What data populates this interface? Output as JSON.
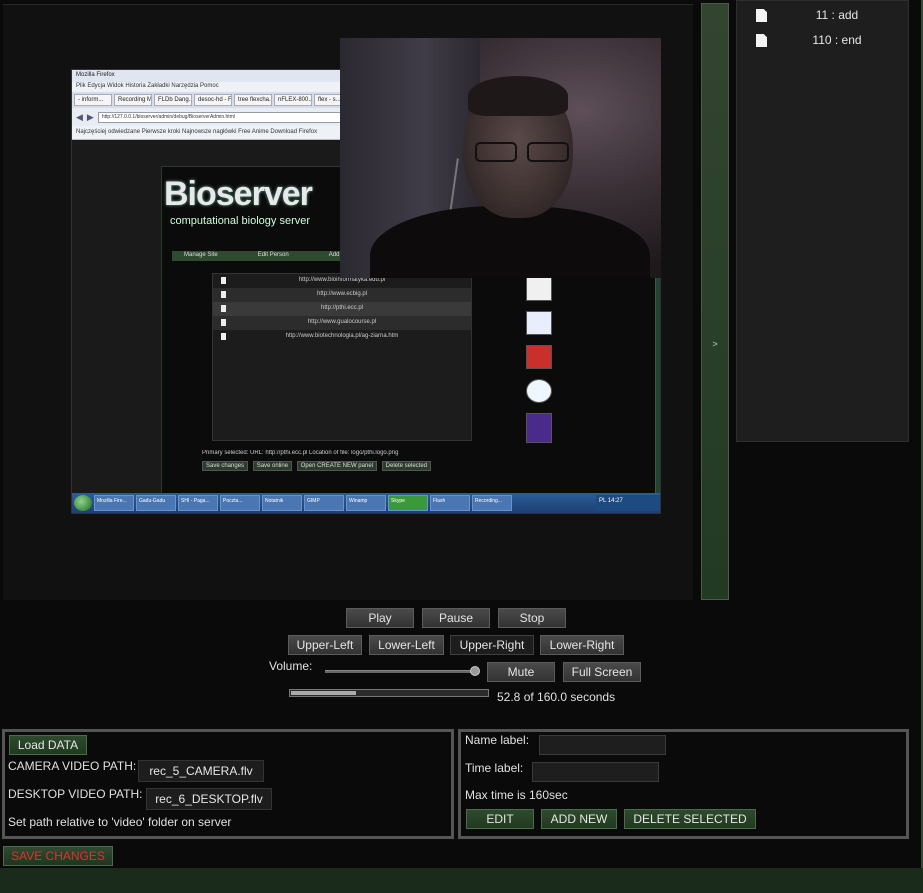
{
  "player": {
    "buttons": {
      "play": "Play",
      "pause": "Pause",
      "stop": "Stop"
    },
    "positions": {
      "upper_left": "Upper-Left",
      "lower_left": "Lower-Left",
      "upper_right": "Upper-Right",
      "lower_right": "Lower-Right"
    },
    "volume_label": "Volume:",
    "volume_level": 1.0,
    "mute": "Mute",
    "full_screen": "Full Screen",
    "progress_fraction": 0.33,
    "time_status": "52.8 of 160.0 seconds",
    "toggle_glyph": ">"
  },
  "events": [
    {
      "label": "11 : add",
      "icon": "document-icon"
    },
    {
      "label": "110 : end",
      "icon": "document-icon"
    }
  ],
  "load_panel": {
    "load_button": "Load DATA",
    "camera_label": "CAMERA VIDEO PATH:",
    "camera_value": "rec_5_CAMERA.flv",
    "desktop_label": "DESKTOP VIDEO PATH:",
    "desktop_value": "rec_6_DESKTOP.flv",
    "hint": "Set path relative to 'video' folder on server"
  },
  "label_panel": {
    "name_label": "Name label:",
    "name_value": "",
    "time_label": "Time label:",
    "time_value": "",
    "max_time": "Max time is 160sec",
    "edit": "EDIT",
    "add_new": "ADD NEW",
    "delete_selected": "DELETE SELECTED"
  },
  "save_changes": "SAVE CHANGES",
  "video_content": {
    "browser": {
      "title": "Mozilla Firefox",
      "menu": "Plik  Edycja  Widok  Historia  Zakładki  Narzędzia  Pomoc",
      "tabs": [
        "- inform...",
        "Recording Me...",
        "FLDb Dang...",
        "desoc-hd - F...",
        "tree flexcha...",
        "nFLEX-800...",
        "flex - s..."
      ],
      "url": "http://127.0.0.1/bioserver/admin/debug/BioserverAdmin.html",
      "bookmarks": "Najczęściej odwiedzane   Pierwsze kroki   Najnowsze nagłówki   Free Anime Download   Firefox"
    },
    "site": {
      "logo": "Bioserver",
      "subtitle": "computational biology server",
      "nav": [
        "Manage Site",
        "Edit Person",
        "Add Person"
      ],
      "links": [
        "http://www.bioinformatyka.edu.pl",
        "http://www.ecbig.pl",
        "http://pthi.ecc.pl",
        "http://www.gualocourse.pl",
        "http://www.biotechnologia.pl/ag-ziarna.htm"
      ],
      "form_text": "Primary selected:  URL: http://pthi.ecc.pl   Location of file: logo/pthi.logo.png",
      "form_buttons": [
        "Save changes",
        "Save online",
        "Open CREATE NEW panel",
        "Delete selected"
      ]
    },
    "taskbar": {
      "items": [
        "Mozilla Fire...",
        "Gadu-Gadu",
        "SHI - Paga...",
        "Poczta...",
        "Notatnik",
        "GIMP",
        "Winamp",
        "Skype",
        "Flash",
        "Recording..."
      ],
      "tray": "PL  14:27"
    }
  }
}
